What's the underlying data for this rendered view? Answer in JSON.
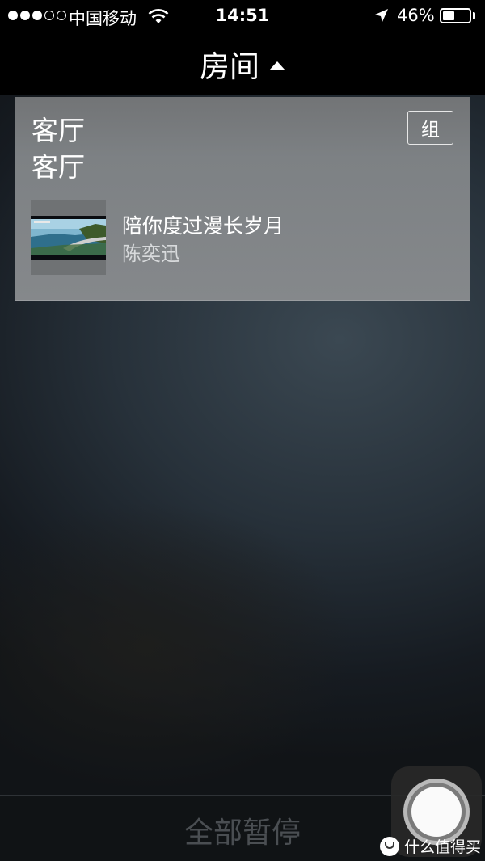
{
  "status_bar": {
    "carrier": "中国移动",
    "time": "14:51",
    "battery_text": "46%",
    "battery_level": 0.46,
    "signal_bars": 3,
    "signal_total": 5
  },
  "header": {
    "title": "房间",
    "caret_icon": "caret-up-icon"
  },
  "room": {
    "name_primary": "客厅",
    "name_secondary": "客厅",
    "group_label": "组",
    "now_playing": {
      "title": "陪你度过漫长岁月",
      "artist": "陈奕迅"
    }
  },
  "footer": {
    "pause_all_label": "全部暂停"
  },
  "watermark": {
    "text": "什么值得买"
  },
  "colors": {
    "card": "#7d8184",
    "header_bg": "#000000",
    "pause_text": "#4a4e52"
  }
}
